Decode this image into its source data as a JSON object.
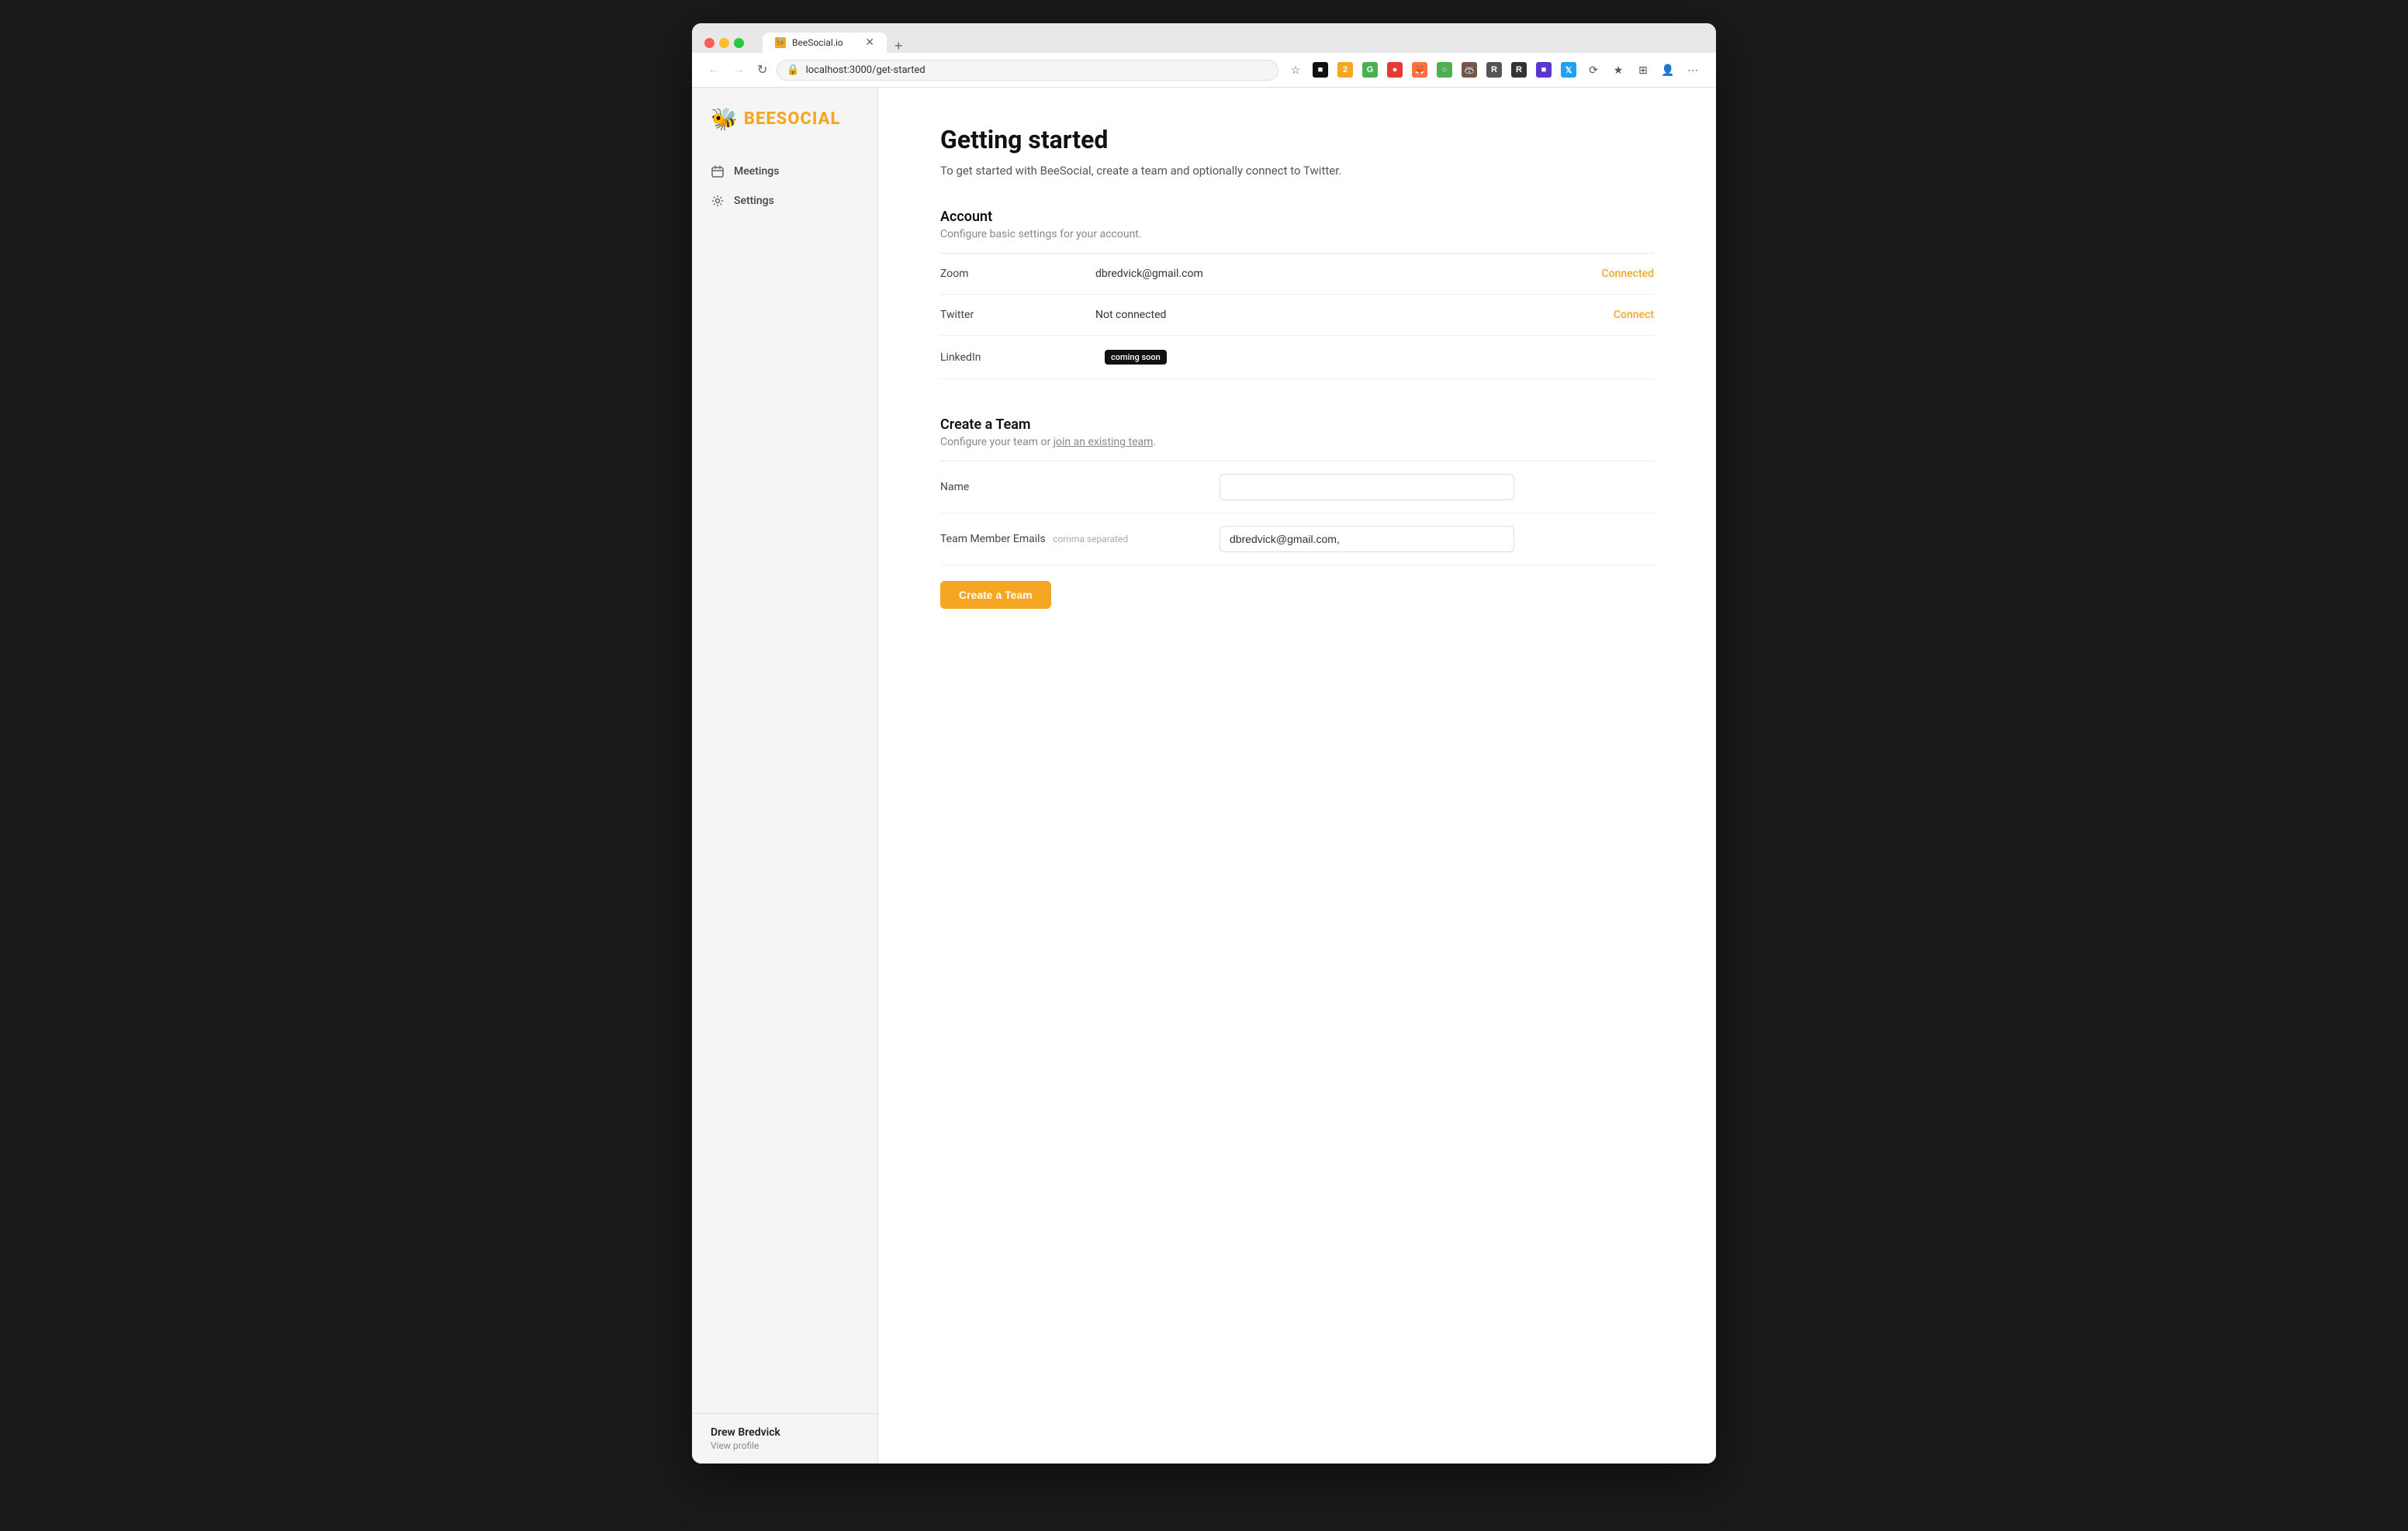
{
  "browser": {
    "url": "localhost:3000/get-started",
    "tab_title": "BeeSocial.io",
    "tab_favicon": "🐝",
    "back_btn": "←",
    "forward_btn": "→",
    "reload_btn": "↻",
    "new_tab_btn": "+"
  },
  "sidebar": {
    "logo_text": "BEESOCIAL",
    "nav_items": [
      {
        "id": "meetings",
        "label": "Meetings",
        "icon": "calendar"
      },
      {
        "id": "settings",
        "label": "Settings",
        "icon": "gear"
      }
    ],
    "user": {
      "name": "Drew Bredvick",
      "profile_link": "View profile"
    }
  },
  "page": {
    "title": "Getting started",
    "subtitle": "To get started with BeeSocial, create a team and optionally connect to Twitter."
  },
  "account_section": {
    "title": "Account",
    "description": "Configure basic settings for your account.",
    "rows": [
      {
        "label": "Zoom",
        "value": "dbredvick@gmail.com",
        "action": "Connected",
        "action_type": "connected"
      },
      {
        "label": "Twitter",
        "value": "Not connected",
        "action": "Connect",
        "action_type": "connect"
      },
      {
        "label": "LinkedIn",
        "value": "",
        "action": "",
        "action_type": "coming_soon",
        "badge": "coming soon"
      }
    ]
  },
  "team_section": {
    "title": "Create a Team",
    "description_prefix": "Configure your team or ",
    "join_link_text": "join an existing team",
    "description_suffix": ".",
    "fields": [
      {
        "label": "Name",
        "label_sub": "",
        "placeholder": "",
        "value": "",
        "id": "team-name"
      },
      {
        "label": "Team Member Emails",
        "label_sub": "comma separated",
        "placeholder": "",
        "value": "dbredvick@gmail.com,",
        "id": "team-emails"
      }
    ],
    "submit_label": "Create a Team"
  }
}
